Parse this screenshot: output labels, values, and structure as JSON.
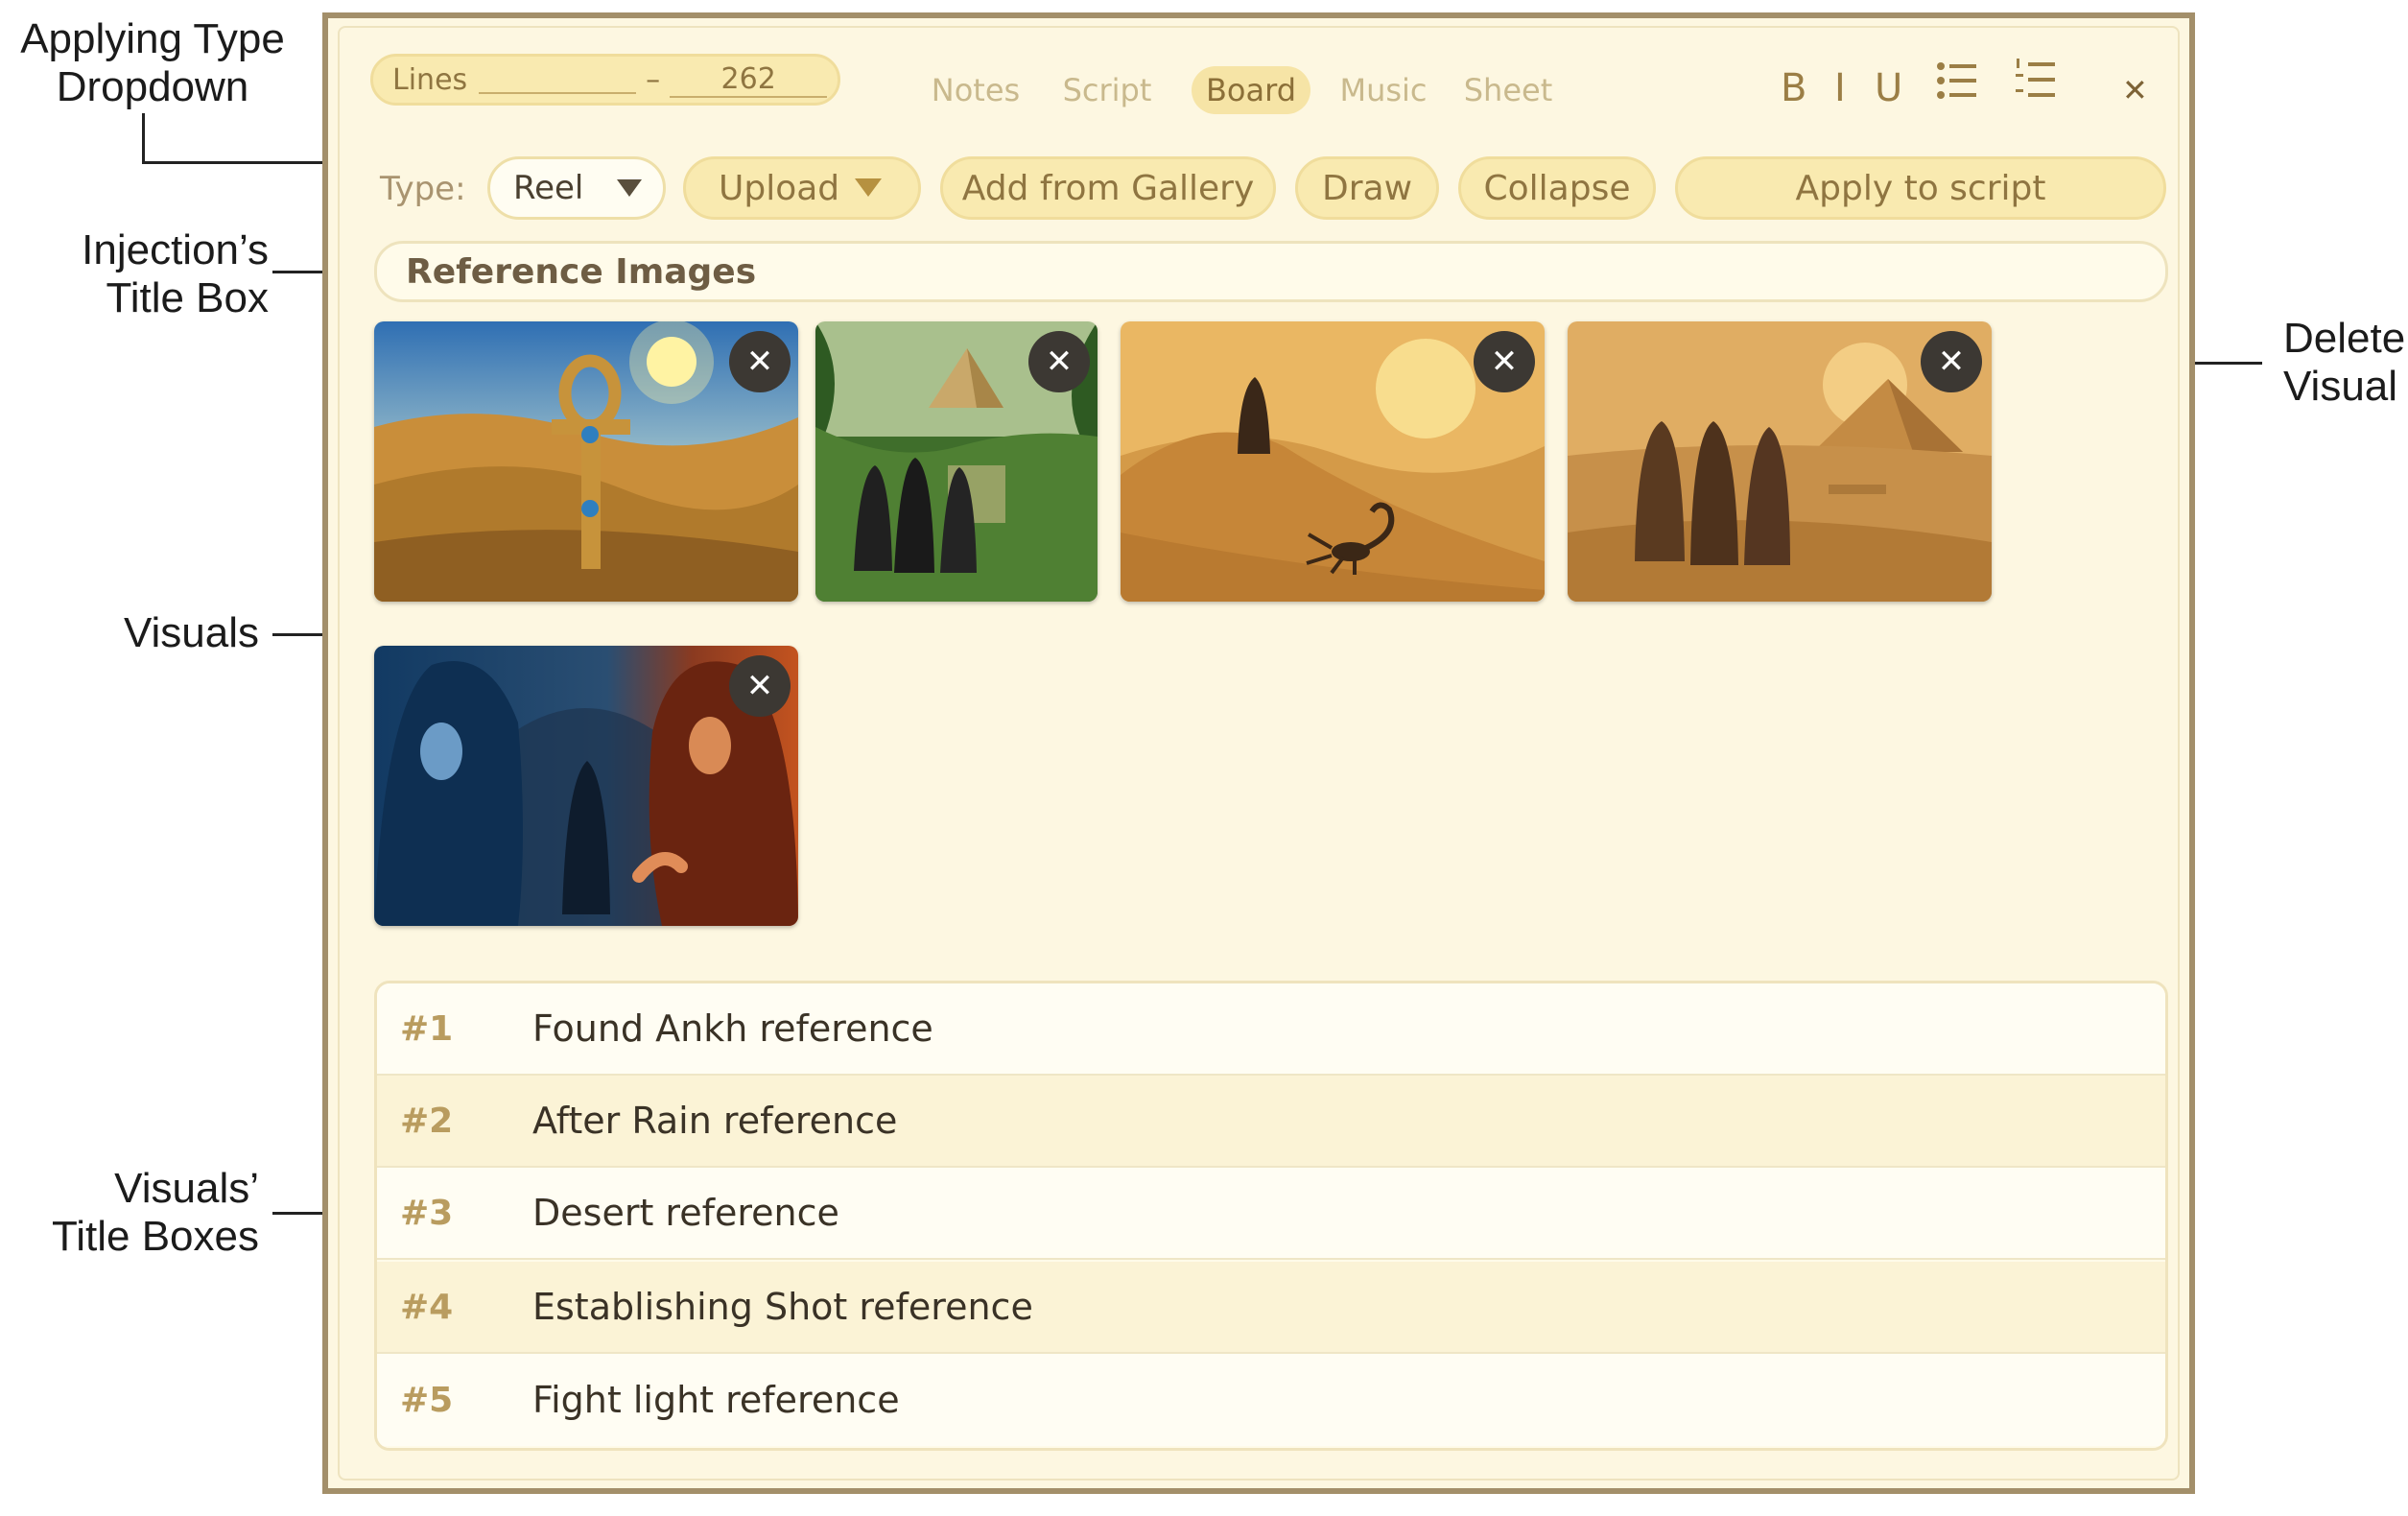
{
  "annotations": {
    "type_dropdown": "Applying Type\nDropdown",
    "title_box": "Injection’s\nTitle Box",
    "visuals": "Visuals",
    "visual_titles": "Visuals’\nTitle Boxes",
    "delete_visual": "Delete\nVisual"
  },
  "header": {
    "lines_label": "Lines",
    "lines_dash": "–",
    "lines_to": "262",
    "tabs": [
      "Notes",
      "Script",
      "Board",
      "Music",
      "Sheet"
    ],
    "active_tab": "Board",
    "format": {
      "bold": "B",
      "italic": "I",
      "underline": "U"
    },
    "close_symbol": "✕"
  },
  "toolbar": {
    "type_label": "Type:",
    "type_value": "Reel",
    "upload_label": "Upload",
    "gallery_label": "Add from Gallery",
    "draw_label": "Draw",
    "collapse_label": "Collapse",
    "apply_label": "Apply to script"
  },
  "injection_title": "Reference Images",
  "visuals": [
    {
      "scene": "ankh-desert",
      "delete_symbol": "✕"
    },
    {
      "scene": "jungle-pyramid",
      "delete_symbol": "✕"
    },
    {
      "scene": "desert-dune-scorpion",
      "delete_symbol": "✕"
    },
    {
      "scene": "desert-pyramid-figures",
      "delete_symbol": "✕"
    },
    {
      "scene": "hooded-figures-tunnel",
      "delete_symbol": "✕"
    }
  ],
  "visual_titles": [
    {
      "num": "#1",
      "title": "Found Ankh reference"
    },
    {
      "num": "#2",
      "title": "After Rain reference"
    },
    {
      "num": "#3",
      "title": "Desert reference"
    },
    {
      "num": "#4",
      "title": "Establishing Shot reference"
    },
    {
      "num": "#5",
      "title": "Fight light reference"
    }
  ],
  "colors": {
    "panel_bg": "#fdf7e1",
    "panel_border": "#a38f6a",
    "pill_bg": "#f9eab0",
    "accent_text": "#8f7541"
  }
}
